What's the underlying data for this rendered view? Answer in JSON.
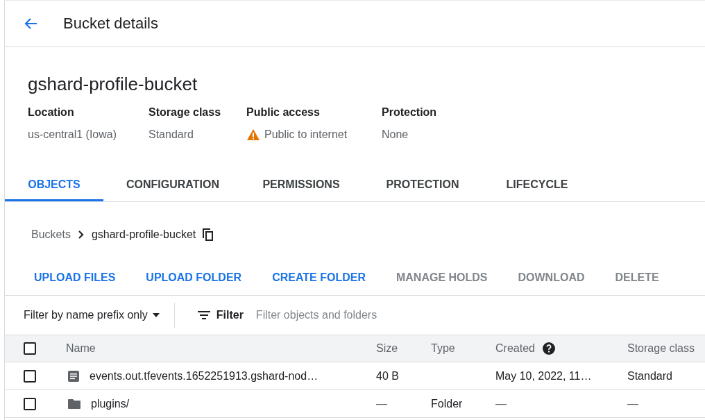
{
  "header": {
    "title": "Bucket details"
  },
  "bucket": {
    "name": "gshard-profile-bucket",
    "properties": [
      {
        "label": "Location",
        "value": "us-central1 (Iowa)",
        "warning": false
      },
      {
        "label": "Storage class",
        "value": "Standard",
        "warning": false
      },
      {
        "label": "Public access",
        "value": "Public to internet",
        "warning": true
      },
      {
        "label": "Protection",
        "value": "None",
        "warning": false
      }
    ]
  },
  "tabs": [
    {
      "label": "OBJECTS",
      "selected": true
    },
    {
      "label": "CONFIGURATION",
      "selected": false
    },
    {
      "label": "PERMISSIONS",
      "selected": false
    },
    {
      "label": "PROTECTION",
      "selected": false
    },
    {
      "label": "LIFECYCLE",
      "selected": false
    }
  ],
  "breadcrumb": {
    "parent": "Buckets",
    "current": "gshard-profile-bucket"
  },
  "actions": [
    {
      "label": "UPLOAD FILES",
      "disabled": false
    },
    {
      "label": "UPLOAD FOLDER",
      "disabled": false
    },
    {
      "label": "CREATE FOLDER",
      "disabled": false
    },
    {
      "label": "MANAGE HOLDS",
      "disabled": true
    },
    {
      "label": "DOWNLOAD",
      "disabled": true
    },
    {
      "label": "DELETE",
      "disabled": true
    }
  ],
  "filter": {
    "mode": "Filter by name prefix only",
    "button": "Filter",
    "placeholder": "Filter objects and folders"
  },
  "table": {
    "header_checked": false,
    "columns": [
      "Name",
      "Size",
      "Type",
      "Created",
      "Storage class"
    ],
    "rows": [
      {
        "kind": "file",
        "checked": false,
        "cells": [
          "events.out.tfevents.1652251913.gshard-nod…",
          "40 B",
          "",
          "May 10, 2022, 11…",
          "Standard"
        ]
      },
      {
        "kind": "folder",
        "checked": false,
        "cells": [
          "plugins/",
          "—",
          "Folder",
          "—",
          "—"
        ]
      }
    ]
  }
}
